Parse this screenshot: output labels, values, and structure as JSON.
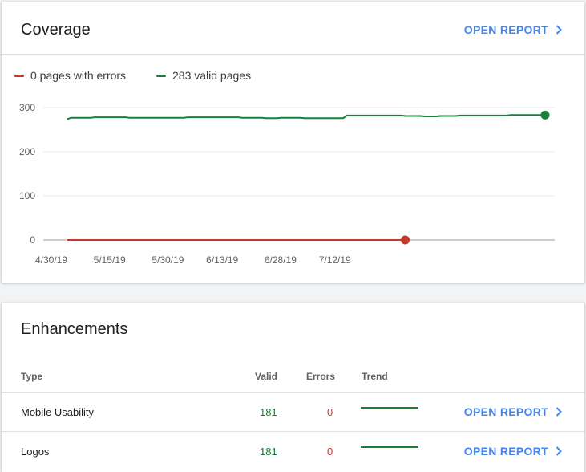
{
  "coverage": {
    "title": "Coverage",
    "open_report_label": "OPEN REPORT",
    "legend": [
      {
        "label": "0 pages with errors",
        "color": "#c5392b"
      },
      {
        "label": "283 valid pages",
        "color": "#188038"
      }
    ]
  },
  "chart_data": {
    "type": "line",
    "title": "",
    "xlabel": "",
    "ylabel": "",
    "ylim": [
      0,
      300
    ],
    "yticks": [
      0,
      100,
      200,
      300
    ],
    "grid": true,
    "legend_position": "top-left",
    "x_tick_labels": [
      "4/30/19",
      "5/15/19",
      "5/30/19",
      "6/13/19",
      "6/28/19",
      "7/12/19"
    ],
    "x_tick_index": [
      0,
      15,
      30,
      44,
      59,
      73
    ],
    "x_dates": [
      "2019-04-30",
      "2019-05-01",
      "2019-05-02",
      "2019-05-03",
      "2019-05-04",
      "2019-05-05",
      "2019-05-06",
      "2019-05-07",
      "2019-05-08",
      "2019-05-09",
      "2019-05-10",
      "2019-05-11",
      "2019-05-12",
      "2019-05-13",
      "2019-05-14",
      "2019-05-15",
      "2019-05-16",
      "2019-05-17",
      "2019-05-18",
      "2019-05-19",
      "2019-05-20",
      "2019-05-21",
      "2019-05-22",
      "2019-05-23",
      "2019-05-24",
      "2019-05-25",
      "2019-05-26",
      "2019-05-27",
      "2019-05-28",
      "2019-05-29",
      "2019-05-30",
      "2019-05-31",
      "2019-06-01",
      "2019-06-02",
      "2019-06-03",
      "2019-06-04",
      "2019-06-05",
      "2019-06-06",
      "2019-06-07",
      "2019-06-08",
      "2019-06-09",
      "2019-06-10",
      "2019-06-11",
      "2019-06-12",
      "2019-06-13",
      "2019-06-14",
      "2019-06-15",
      "2019-06-16",
      "2019-06-17",
      "2019-06-18",
      "2019-06-19",
      "2019-06-20",
      "2019-06-21",
      "2019-06-22",
      "2019-06-23",
      "2019-06-24",
      "2019-06-25",
      "2019-06-26",
      "2019-06-27",
      "2019-06-28",
      "2019-06-29",
      "2019-06-30",
      "2019-07-01",
      "2019-07-02",
      "2019-07-03",
      "2019-07-04",
      "2019-07-05",
      "2019-07-06",
      "2019-07-07",
      "2019-07-08",
      "2019-07-09",
      "2019-07-10",
      "2019-07-11",
      "2019-07-12",
      "2019-07-13",
      "2019-07-14",
      "2019-07-15",
      "2019-07-16",
      "2019-07-17",
      "2019-07-18",
      "2019-07-19",
      "2019-07-20",
      "2019-07-21",
      "2019-07-22",
      "2019-07-23",
      "2019-07-24",
      "2019-07-25",
      "2019-07-26"
    ],
    "series": [
      {
        "name": "283 valid pages",
        "color": "#188038",
        "values": [
          274,
          277,
          277,
          277,
          277,
          277,
          277,
          278,
          278,
          278,
          278,
          278,
          278,
          278,
          278,
          278,
          277,
          277,
          277,
          277,
          277,
          277,
          277,
          277,
          277,
          277,
          277,
          277,
          277,
          277,
          277,
          278,
          278,
          278,
          278,
          278,
          278,
          278,
          278,
          278,
          278,
          278,
          278,
          278,
          278,
          277,
          277,
          277,
          277,
          277,
          277,
          276,
          276,
          276,
          276,
          277,
          277,
          277,
          277,
          277,
          277,
          276,
          276,
          276,
          276,
          276,
          276,
          276,
          276,
          276,
          276,
          276,
          282,
          282,
          282,
          282,
          282,
          282,
          282,
          282,
          282,
          282,
          282,
          282,
          282,
          282,
          282,
          281,
          281,
          281,
          281,
          281,
          280,
          280,
          280,
          280,
          281,
          281,
          281,
          281,
          281,
          282,
          282,
          282,
          282,
          282,
          282,
          282,
          282,
          282,
          282,
          282,
          282,
          282,
          283,
          283,
          283,
          283,
          283,
          283,
          283,
          283,
          283,
          283
        ]
      },
      {
        "name": "0 pages with errors",
        "color": "#c5392b",
        "values": [
          0,
          0,
          0,
          0,
          0,
          0,
          0,
          0,
          0,
          0,
          0,
          0,
          0,
          0,
          0,
          0,
          0,
          0,
          0,
          0,
          0,
          0,
          0,
          0,
          0,
          0,
          0,
          0,
          0,
          0,
          0,
          0,
          0,
          0,
          0,
          0,
          0,
          0,
          0,
          0,
          0,
          0,
          0,
          0,
          0,
          0,
          0,
          0,
          0,
          0,
          0,
          0,
          0,
          0,
          0,
          0,
          0,
          0,
          0,
          0,
          0,
          0,
          0,
          0,
          0,
          0,
          0,
          0,
          0,
          0,
          0,
          0,
          0,
          0,
          0,
          0,
          0,
          0,
          0,
          0,
          0,
          0,
          0,
          0,
          0,
          0,
          0,
          0
        ]
      }
    ]
  },
  "enhancements": {
    "title": "Enhancements",
    "columns": {
      "type": "Type",
      "valid": "Valid",
      "errors": "Errors",
      "trend": "Trend"
    },
    "rows": [
      {
        "type": "Mobile Usability",
        "valid": "181",
        "errors": "0",
        "open_report_label": "OPEN REPORT"
      },
      {
        "type": "Logos",
        "valid": "181",
        "errors": "0",
        "open_report_label": "OPEN REPORT"
      }
    ],
    "trend_color": "#188038"
  },
  "icons": {
    "open_report": "chevron-right-icon"
  }
}
